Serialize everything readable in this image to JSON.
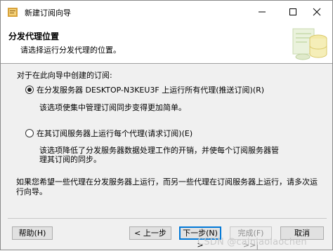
{
  "window": {
    "title": "新建订阅向导"
  },
  "header": {
    "title": "分发代理位置",
    "subtitle": "请选择运行分发代理的位置。"
  },
  "body": {
    "label": "对于在此向导中创建的订阅:",
    "option1": {
      "label": "在分发服务器 DESKTOP-N3KEU3F 上运行所有代理(推送订阅)(R)",
      "checked": true,
      "description": "该选项使集中管理订阅同步变得更加简单。"
    },
    "option2": {
      "label": "在其订阅服务器上运行每个代理(请求订阅)(E)",
      "checked": false,
      "description": "该选项降低了分发服务器数据处理工作的开销，并使每个订阅服务器管理其订阅的同步。"
    },
    "note": "如果您希望一些代理在分发服务器上运行，而另一些代理在订阅服务器上运行，请多次运行向导。"
  },
  "buttons": {
    "help": "帮助(H)",
    "back": "< 上一步",
    "next": "下一步(N) >",
    "finish": "完成(F) >>|",
    "cancel": "取消"
  },
  "watermark": "CSDN @cainiaolaochen"
}
